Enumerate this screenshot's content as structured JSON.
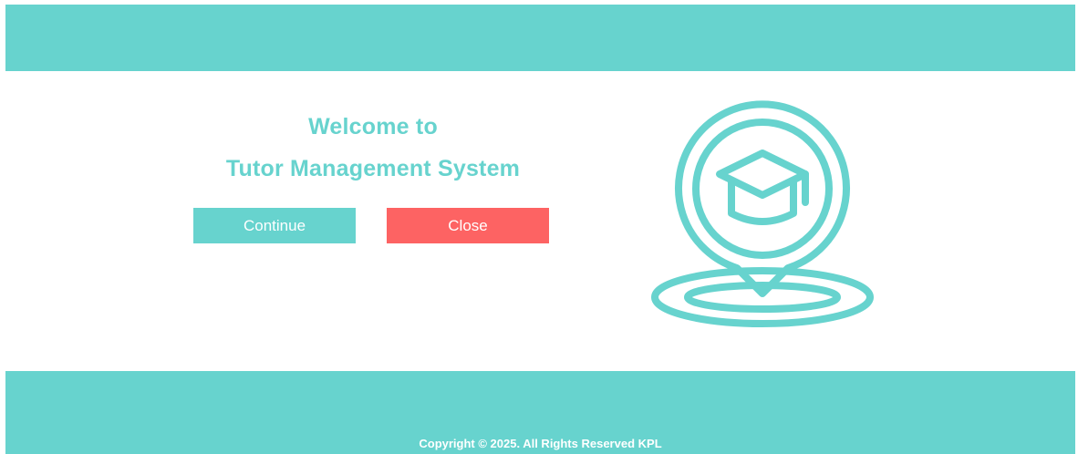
{
  "header": {},
  "welcome": {
    "line1": "Welcome to",
    "line2": "Tutor Management System"
  },
  "buttons": {
    "continue_label": "Continue",
    "close_label": "Close"
  },
  "graphic": {
    "icon": "graduation-cap-location-pin-icon"
  },
  "footer": {
    "copyright": "Copyright © 2025. All Rights Reserved KPL"
  },
  "colors": {
    "accent": "#67d3ce",
    "close": "#fd6363",
    "background": "#ffffff",
    "text_on_accent": "#ffffff"
  }
}
